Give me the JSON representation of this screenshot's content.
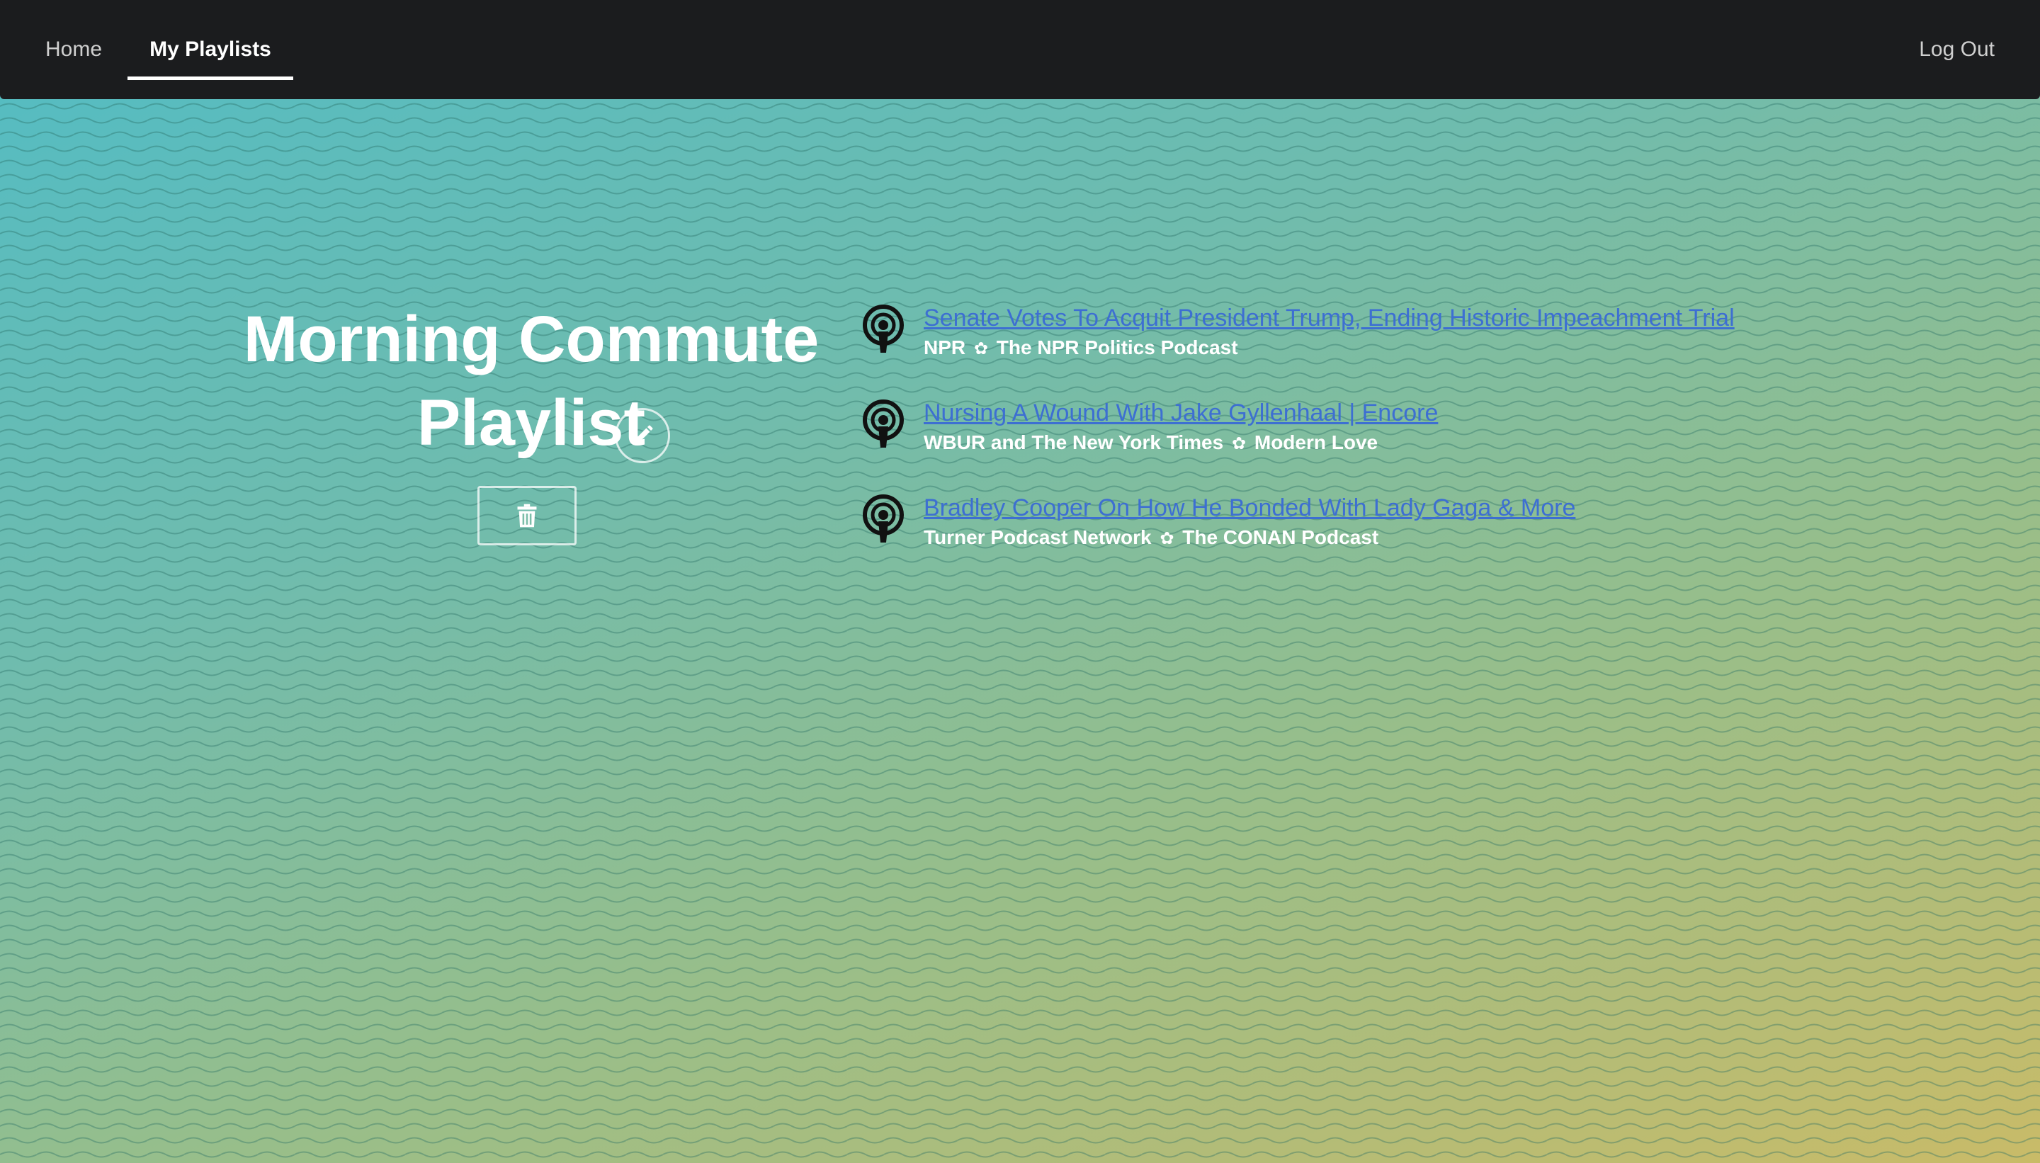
{
  "nav": {
    "home_label": "Home",
    "playlists_label": "My Playlists",
    "logout_label": "Log Out"
  },
  "playlist": {
    "title_line1": "Morning Commute",
    "title_line2": "Playlist",
    "edit_icon": "pencil-icon",
    "delete_icon": "trash-icon"
  },
  "episodes": [
    {
      "title": "Senate Votes To Acquit President Trump, Ending Historic Impeachment Trial",
      "publisher": "NPR",
      "podcast": "The NPR Politics Podcast",
      "icon": "podcast-icon"
    },
    {
      "title": "Nursing A Wound With Jake Gyllenhaal | Encore",
      "publisher": "WBUR and The New York Times",
      "podcast": "Modern Love",
      "icon": "podcast-icon"
    },
    {
      "title": "Bradley Cooper On How He Bonded With Lady Gaga & More",
      "publisher": "Turner Podcast Network",
      "podcast": "The CONAN Podcast",
      "icon": "podcast-icon"
    }
  ],
  "separator": "✿",
  "colors": {
    "navbar": "#1b1c1e",
    "link": "#3d6fd2",
    "gradient_start": "#52bcc4",
    "gradient_end": "#c9bb68"
  }
}
